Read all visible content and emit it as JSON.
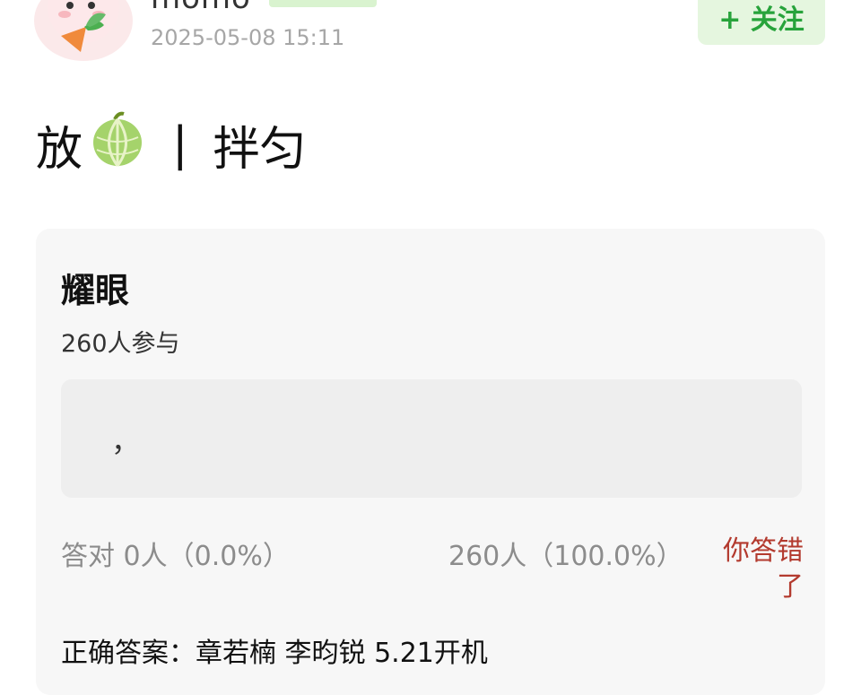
{
  "header": {
    "username": "momo",
    "timestamp": "2025-05-08 15:11",
    "follow_label": "+ 关注",
    "avatar_icon": "bunny-carrot-avatar-icon"
  },
  "post": {
    "text_before": "放",
    "emoji_icon": "melon-icon",
    "separator": "|",
    "text_after": "拌匀"
  },
  "quiz": {
    "title": "耀眼",
    "participants": "260人参与",
    "option_text": "，",
    "correct_stat": "答对  0人（0.0%）",
    "wrong_stat": "260人（100.0%）",
    "wrong_label": "你答错了",
    "answer": "正确答案：章若楠 李昀锐 5.21开机"
  },
  "colors": {
    "accent_green": "#27a33b",
    "follow_bg": "#e5f6df",
    "wrong_red": "#b33a2e",
    "muted": "#8c8c8c"
  }
}
